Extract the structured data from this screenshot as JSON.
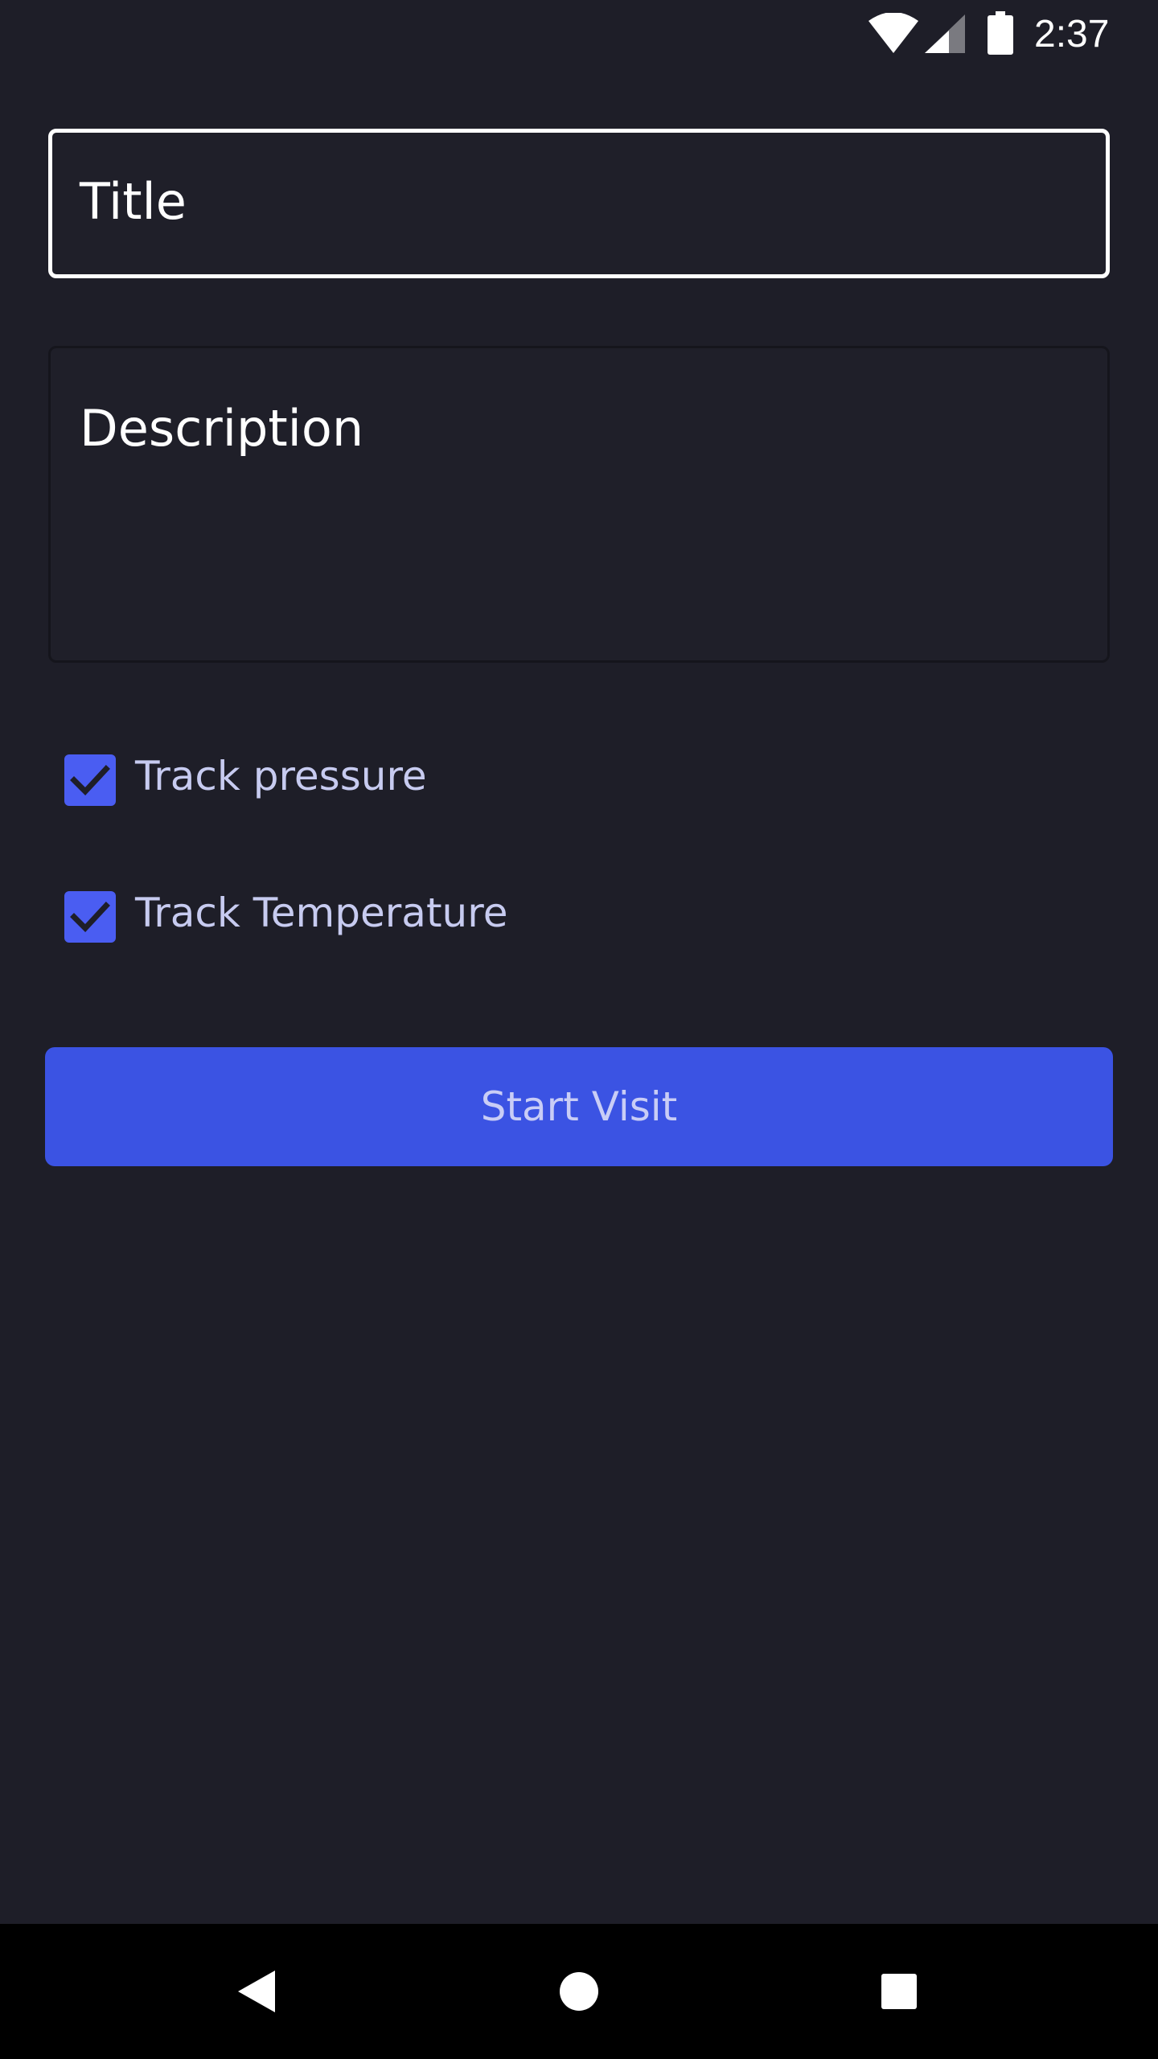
{
  "status_bar": {
    "time": "2:37",
    "icons": [
      "wifi-icon",
      "cell-signal-icon",
      "battery-icon"
    ]
  },
  "form": {
    "title_placeholder": "Title",
    "description_placeholder": "Description",
    "options": [
      {
        "label": "Track pressure",
        "checked": true
      },
      {
        "label": "Track Temperature",
        "checked": true
      }
    ],
    "start_label": "Start Visit"
  },
  "nav_bar": {
    "icons": [
      "back-icon",
      "home-icon",
      "recents-icon"
    ]
  },
  "colors": {
    "background": "#1e1e28",
    "accent": "#3b53e3",
    "checkbox": "#4a5df2"
  }
}
